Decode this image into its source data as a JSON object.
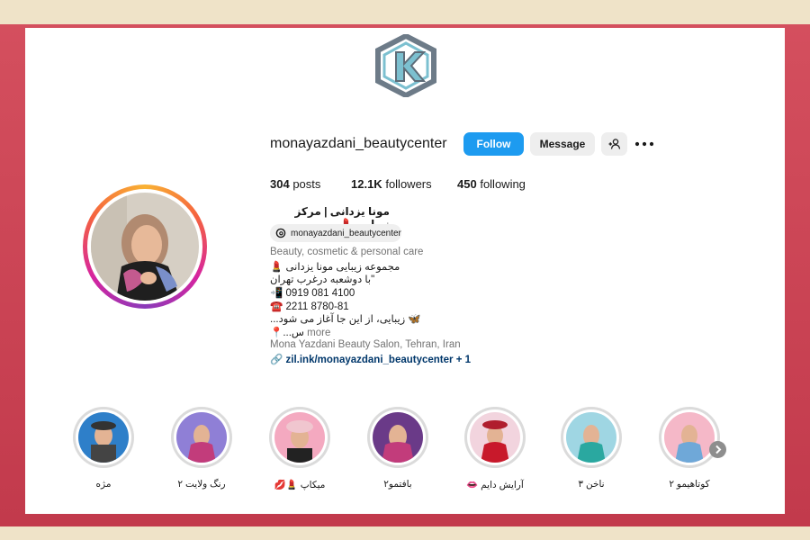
{
  "profile": {
    "username": "monayazdani_beautycenter",
    "follow_label": "Follow",
    "message_label": "Message",
    "add_user_icon": "add-person-icon",
    "more_icon": "more-dots-icon"
  },
  "stats": {
    "posts_count": "304",
    "posts_label": "posts",
    "followers_count": "12.1K",
    "followers_label": "followers",
    "following_count": "450",
    "following_label": "following"
  },
  "bio": {
    "full_name": "مونا یزدانی | مرکز زیبایی",
    "threads_handle": "monayazdani_beautycenter",
    "category": "Beauty, cosmetic & personal care",
    "line1": "مجموعه زیبایی مونا یزدانی",
    "line2": "با دوشعبه درغرب تهران",
    "phone1": "0919 081 4100",
    "phone2": "2211 8780-81",
    "line5": "...زیبایی، از این جا آغاز می شود",
    "line6": "...س",
    "more_label": "more",
    "address": "Mona Yazdani Beauty Salon, Tehran, Iran",
    "link": "zil.ink/monayazdani_beautycenter",
    "link_extra": "+ 1"
  },
  "highlights": [
    {
      "label": "مژه"
    },
    {
      "label": "رنگ ولایت ۲"
    },
    {
      "label": "میکاپ 💄💋"
    },
    {
      "label": "بافتمو۲"
    },
    {
      "label": "آرایش دایم 👄"
    },
    {
      "label": "ناخن ۳"
    },
    {
      "label": "کوتاهیمو ۲"
    }
  ],
  "colors": {
    "accent": "#1d9bf0",
    "frame": "#c8424f",
    "logo": "#6fb3c6"
  }
}
